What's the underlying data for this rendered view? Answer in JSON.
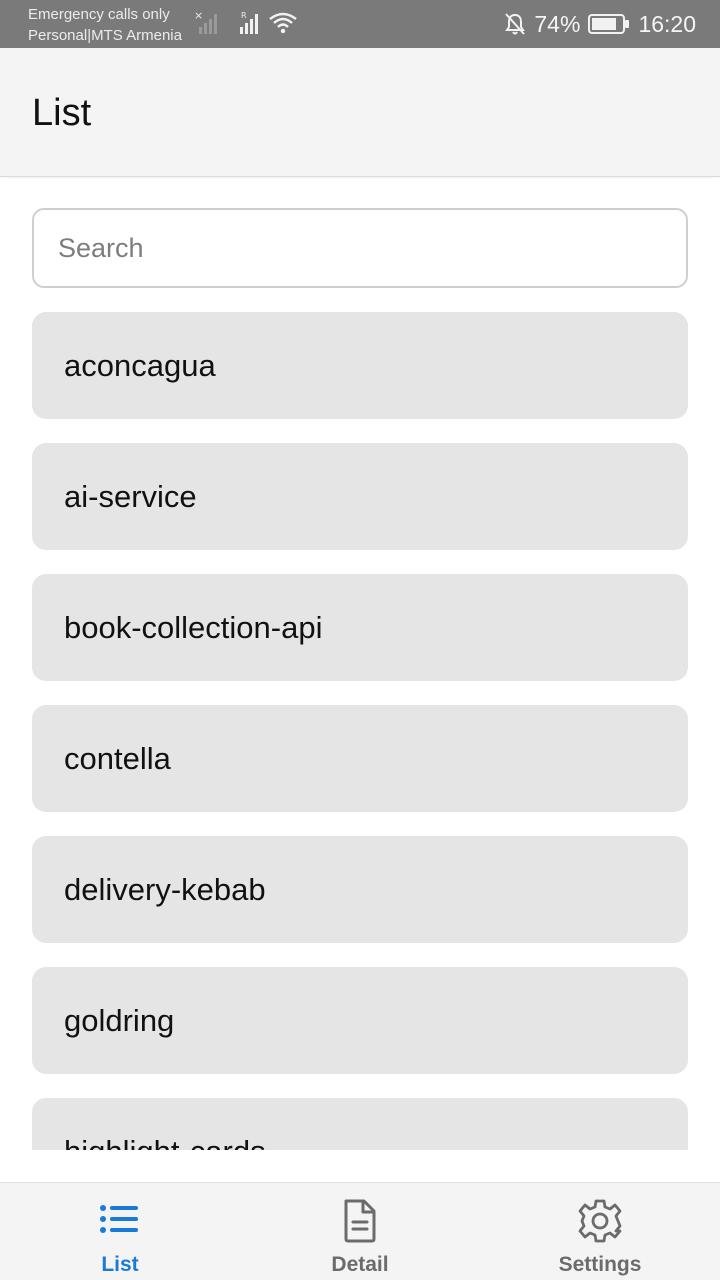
{
  "status_bar": {
    "carrier_line1": "Emergency calls only",
    "carrier_line2": "Personal|MTS Armenia",
    "battery": "74%",
    "time": "16:20",
    "icons": [
      "sim-no-signal-icon",
      "signal-icon",
      "wifi-icon",
      "notifications-off-icon",
      "battery-icon"
    ]
  },
  "header": {
    "title": "List"
  },
  "search": {
    "placeholder": "Search",
    "value": ""
  },
  "list": {
    "items": [
      {
        "label": "aconcagua"
      },
      {
        "label": "ai-service"
      },
      {
        "label": "book-collection-api"
      },
      {
        "label": "contella"
      },
      {
        "label": "delivery-kebab"
      },
      {
        "label": "goldring"
      },
      {
        "label": "highlight-cards"
      }
    ]
  },
  "bottom_nav": {
    "tabs": [
      {
        "label": "List",
        "icon": "list-icon",
        "active": true
      },
      {
        "label": "Detail",
        "icon": "document-icon",
        "active": false
      },
      {
        "label": "Settings",
        "icon": "gear-icon",
        "active": false
      }
    ]
  },
  "colors": {
    "accent": "#1a7ad8",
    "item_bg": "#e5e5e5",
    "header_bg": "#f4f4f4",
    "status_bar_bg": "#7a7a7a"
  }
}
